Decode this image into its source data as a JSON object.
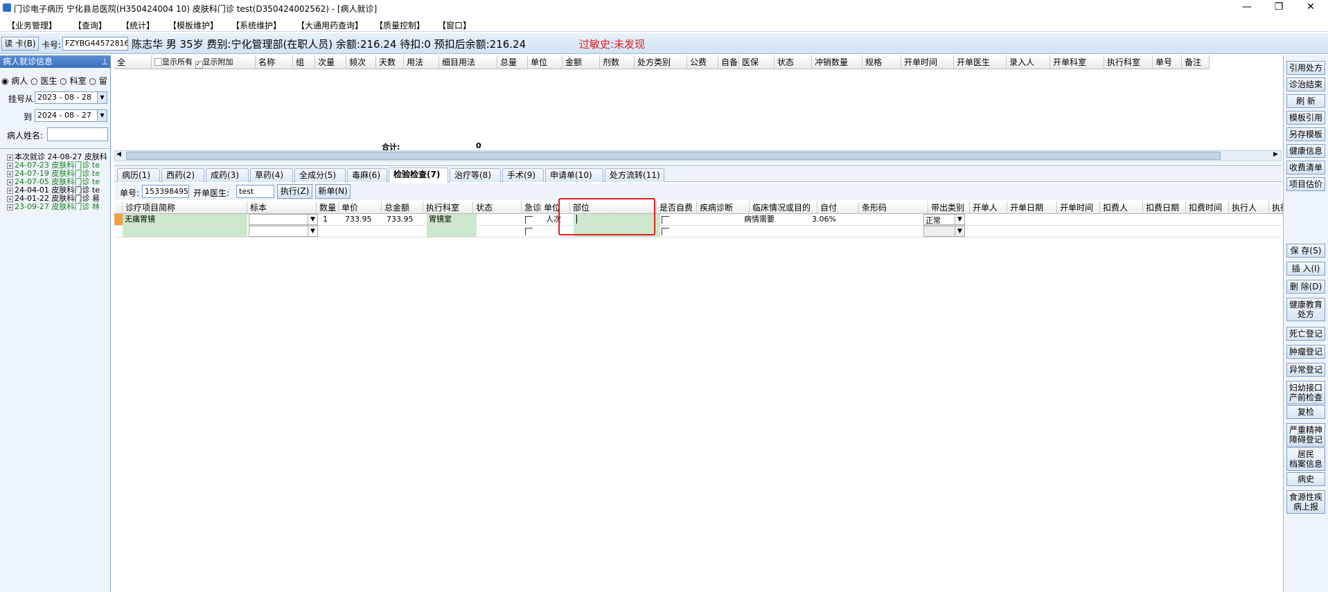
{
  "title": "门诊电子病历  宁化县总医院(H350424004 10)  皮肤科门诊  test(D350424002562) - [病人就诊]",
  "menu": [
    "【业务管理】",
    "【查询】",
    "【统计】",
    "【模板维护】",
    "【系统维护】",
    "【大通用药查询】",
    "【质量控制】",
    "【窗口】"
  ],
  "patient": {
    "read_card": "读 卡(B)",
    "card_label": "卡号:",
    "card_no": "FZYBG44572816",
    "info": "陈志华  男  35岁  费别:宁化管理部(在职人员) 余额:216.24  待扣:0  预扣后余额:216.24",
    "allergy": "过敏史:未发现"
  },
  "left": {
    "title": "病人就诊信息",
    "pin": "⊥",
    "radios": [
      "病人",
      "医生",
      "科室",
      "留"
    ],
    "reg_from_label": "挂号从",
    "reg_from": "2023 - 08 - 28",
    "reg_to_label": "到",
    "reg_to": "2024 - 08 - 27",
    "name_label": "病人姓名:",
    "tree": [
      {
        "text": "本次就诊 24-08-27 皮肤科",
        "color": "#000"
      },
      {
        "text": "24-07-23 皮肤科门诊 te",
        "color": "#1a7a1a"
      },
      {
        "text": "24-07-19 皮肤科门诊 te",
        "color": "#1a7a1a"
      },
      {
        "text": "24-07-05 皮肤科门诊 te",
        "color": "#1a7a1a"
      },
      {
        "text": "24-04-01 皮肤科门诊 te",
        "color": "#000"
      },
      {
        "text": "24-01-22 皮肤科门诊 易",
        "color": "#000"
      },
      {
        "text": "23-09-27 皮肤科门诊 林",
        "color": "#1a7a1a"
      }
    ]
  },
  "rx_grid": {
    "col_all": "全",
    "show_all": "显示所有",
    "show_extra": "显示附加",
    "headers": [
      "名称",
      "组",
      "次量",
      "频次",
      "天数",
      "用法",
      "细目用法",
      "总量",
      "单位",
      "金额",
      "剂数",
      "处方类别",
      "公费",
      "自备",
      "医保",
      "状态",
      "冲销数量",
      "规格",
      "开单时间",
      "开单医生",
      "录入人",
      "开单科室",
      "执行科室",
      "单号",
      "备注"
    ],
    "total_label": "合计:",
    "total_value": "0"
  },
  "tabs": [
    "病历(1)",
    "西药(2)",
    "成药(3)",
    "草药(4)",
    "全成分(5)",
    "毒麻(6)",
    "检验检查(7)",
    "治疗等(8)",
    "手术(9)",
    "申请单(10)",
    "处方流转(11)"
  ],
  "active_tab": 6,
  "order_bar": {
    "no_label": "单号:",
    "no": "153398495",
    "doctor_label": "开单医生:",
    "doctor": "test",
    "exec_btn": "执行(Z)",
    "new_btn": "新单(N)"
  },
  "exam_grid": {
    "headers": [
      "诊疗项目简称",
      "标本",
      "数量",
      "单价",
      "总金额",
      "执行科室",
      "状态",
      "急诊",
      "单位",
      "部位",
      "是否自费",
      "疾病诊断",
      "临床情况或目的",
      "自付",
      "条形码",
      "带出类别",
      "开单人",
      "开单日期",
      "开单时间",
      "扣费人",
      "扣费日期",
      "扣费时间",
      "执行人",
      "执行"
    ],
    "row1": {
      "name": "无痛胃镜",
      "qty": "1",
      "price": "733.95",
      "total": "733.95",
      "dept": "胃镜室",
      "unit": "人次",
      "purpose": "病情需要",
      "self_pay": "3.06%",
      "category": "正常"
    }
  },
  "right_top": [
    "引用处方",
    "诊治结束",
    "刷 新",
    "模板引用",
    "另存模板",
    "健康信息",
    "收费清单",
    "项目估价"
  ],
  "right_bottom": [
    "保 存(S)",
    "插 入(I)",
    "删 除(D)",
    "健康教育\n处方",
    "死亡登记",
    "肿瘤登记",
    "异常登记",
    "妇幼接口\n产前检查",
    "复检",
    "严重精神\n障碍登记",
    "居民\n档案信息",
    "病史",
    "食源性疾\n病上报"
  ],
  "highlight_color": "#e02020",
  "accent": "#3c6fbd"
}
